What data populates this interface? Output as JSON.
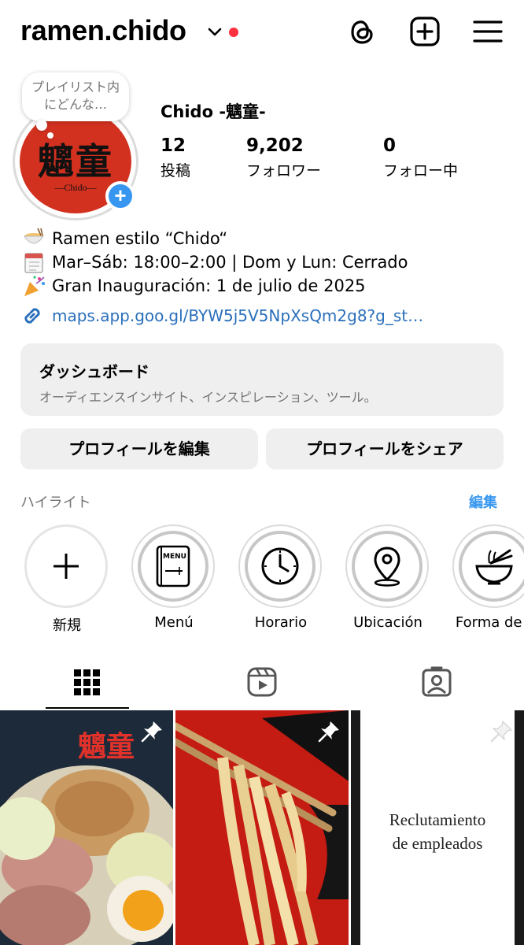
{
  "header": {
    "username": "ramen.chido",
    "icons": [
      "chevron-down-icon",
      "threads-icon",
      "create-plus-icon",
      "menu-icon"
    ],
    "notification_dot_color": "#ff3040"
  },
  "profile": {
    "note": "プレイリスト内にどんな…",
    "avatar_text": "魑童",
    "avatar_subtext": "—Chido—",
    "display_name": "Chido -魑童-",
    "stats": [
      {
        "value": "12",
        "label": "投稿"
      },
      {
        "value": "9,202",
        "label": "フォロワー"
      },
      {
        "value": "0",
        "label": "フォロー中"
      }
    ]
  },
  "bio": {
    "lines": [
      {
        "icon": "ramen-bowl-emoji",
        "text": "Ramen estilo “Chido“"
      },
      {
        "icon": "calendar-emoji",
        "text": "Mar–Sáb: 18:00–2:00 | Dom y Lun: Cerrado"
      },
      {
        "icon": "party-popper-emoji",
        "text": "Gran Inauguración: 1 de julio de 2025"
      }
    ],
    "link": "maps.app.goo.gl/BYW5j5V5NpXsQm2g8?g_st…"
  },
  "dashboard": {
    "title": "ダッシュボード",
    "subtitle": "オーディエンスインサイト、インスピレーション、ツール。"
  },
  "buttons": {
    "edit_profile": "プロフィールを編集",
    "share_profile": "プロフィールをシェア"
  },
  "highlights": {
    "header": "ハイライト",
    "edit": "編集",
    "items": [
      {
        "label": "新規",
        "icon": "plus-icon"
      },
      {
        "label": "Menú",
        "icon": "menu-book-icon",
        "icon_text": "MENU"
      },
      {
        "label": "Horario",
        "icon": "clock-icon"
      },
      {
        "label": "Ubicación",
        "icon": "location-pin-icon"
      },
      {
        "label": "Forma de c",
        "icon": "noodle-bowl-icon"
      }
    ]
  },
  "tabs": [
    "grid-icon",
    "reels-icon",
    "tagged-icon"
  ],
  "posts": [
    {
      "kind": "photo",
      "caption": "魑童",
      "pinned": true
    },
    {
      "kind": "photo",
      "pinned": true
    },
    {
      "kind": "text",
      "text_lines": [
        "Reclutamiento",
        "de empleados"
      ],
      "pinned": true
    }
  ],
  "colors": {
    "accent": "#3797f0",
    "link": "#2a6fba",
    "avatar_red": "#d3311f",
    "button_bg": "#efefef",
    "muted_text": "#737373"
  }
}
